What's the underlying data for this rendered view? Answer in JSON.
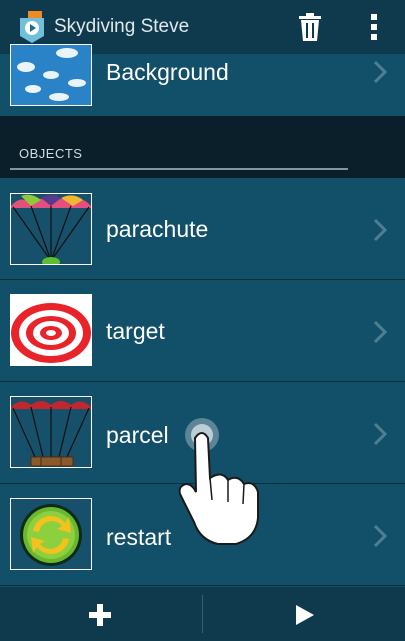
{
  "app": {
    "title": "Skydiving Steve",
    "icons": {
      "app": "app-logo-icon",
      "trash": "trash-icon",
      "overflow": "overflow-menu-icon"
    }
  },
  "background_row": {
    "label": "Background",
    "thumbnail": "clouds-thumbnail"
  },
  "section": {
    "title": "OBJECTS"
  },
  "objects": [
    {
      "label": "parachute",
      "thumbnail": "parachute-thumbnail"
    },
    {
      "label": "target",
      "thumbnail": "target-thumbnail"
    },
    {
      "label": "parcel",
      "thumbnail": "parcel-thumbnail"
    },
    {
      "label": "restart",
      "thumbnail": "restart-thumbnail"
    }
  ],
  "bottom_bar": {
    "add_icon": "plus-icon",
    "play_icon": "play-icon"
  },
  "colors": {
    "app_bar": "#0f3a4d",
    "row": "#124f68",
    "section_bg": "#0a1f2a",
    "text": "#ffffff"
  }
}
